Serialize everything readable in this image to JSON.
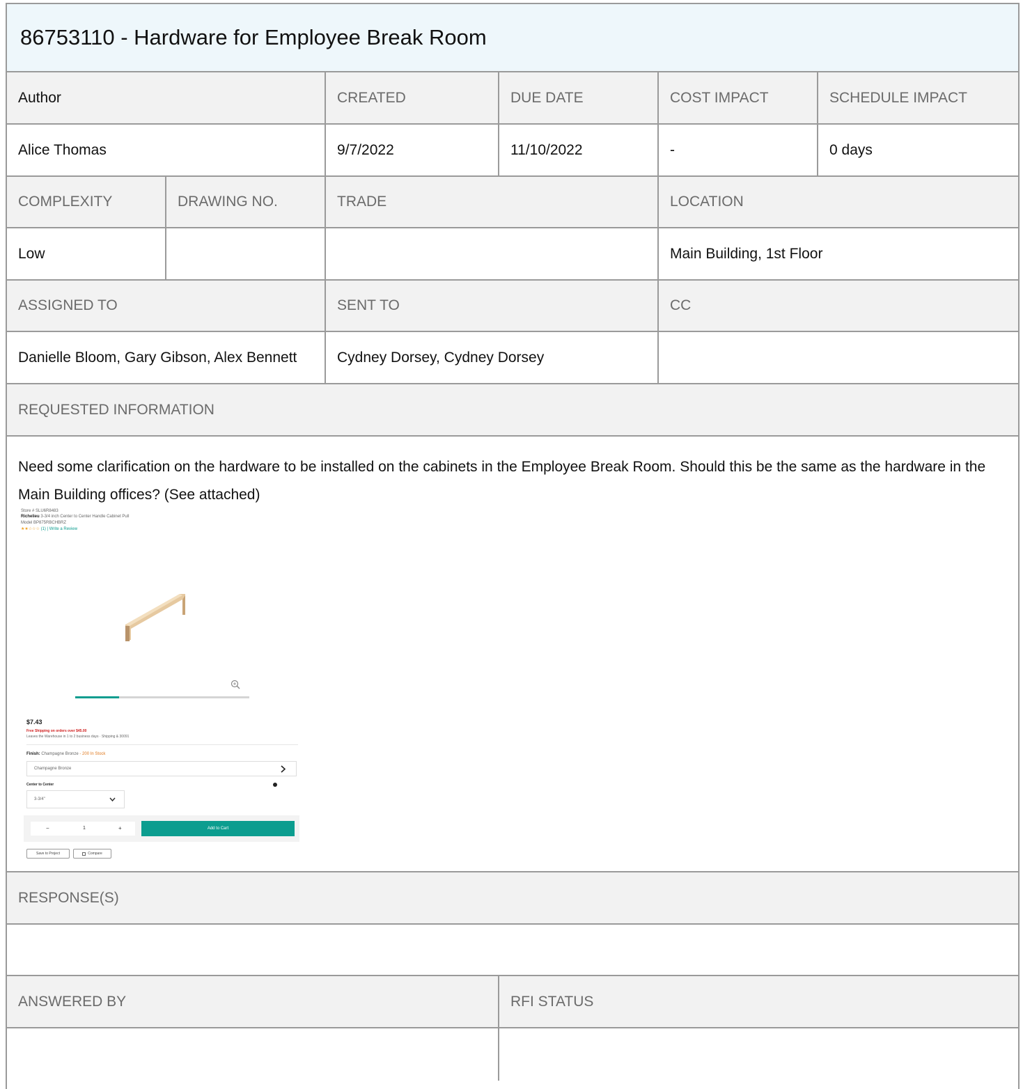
{
  "title": "86753110 - Hardware for Employee Break Room",
  "headers_row1": [
    "Author",
    "CREATED",
    "DUE DATE",
    "COST IMPACT",
    "SCHEDULE IMPACT"
  ],
  "values_row1": [
    "Alice Thomas",
    "9/7/2022",
    "11/10/2022",
    "-",
    "0 days"
  ],
  "headers_row2": [
    "COMPLEXITY",
    "DRAWING NO.",
    "TRADE",
    "LOCATION"
  ],
  "values_row2": [
    "Low",
    "",
    "",
    "Main Building, 1st Floor"
  ],
  "headers_row3": [
    "ASSIGNED TO",
    "SENT TO",
    "CC"
  ],
  "values_row3": [
    "Danielle Bloom, Gary Gibson, Alex Bennett",
    "Cydney Dorsey, Cydney Dorsey",
    ""
  ],
  "requested_information": {
    "label": "REQUESTED INFORMATION",
    "text": "Need some clarification on the hardware to be installed on the cabinets in the Employee Break Room. Should this be the same as the hardware in the Main Building offices? (See attached)"
  },
  "attachment": {
    "store_sku": "Store # SLU6R8483",
    "brand": "Richelieu",
    "product": "3-3/4 inch Center to Center Handle Cabinet Pull",
    "model": "Model BP875RBCHBRZ",
    "reviews": "(1) | Write a Review",
    "price": "$7.43",
    "shipping": "Free Shipping on orders over $45.00",
    "leaves": "Leaves the Warehouse in 1 to 2 business days · Shipping & 30091",
    "finish_label": "Finish:",
    "finish_value": "Champagne Bronze",
    "stock": "- 200 In Stock",
    "finish_select": "Champagne Bronze",
    "ctc_label": "Center to Center",
    "ctc_value": "3-3/4\"",
    "qty_minus": "−",
    "qty_value": "1",
    "qty_plus": "+",
    "add_to_cart": "Add to Cart",
    "save_project": "Save to Project",
    "compare": "Compare",
    "accent": "#0c9d8f"
  },
  "responses_label": "RESPONSE(S)",
  "headers_row4": [
    "ANSWERED BY",
    "RFI STATUS"
  ],
  "values_row4": [
    "",
    ""
  ]
}
